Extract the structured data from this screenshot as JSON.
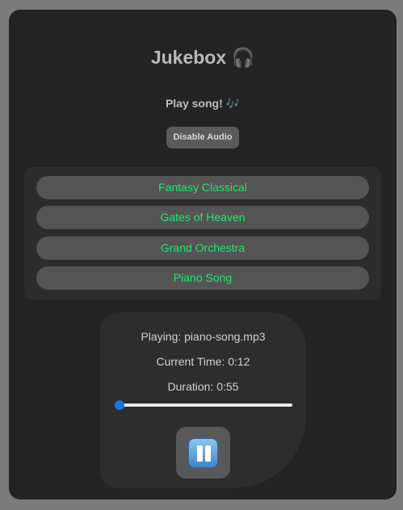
{
  "header": {
    "title": "Jukebox 🎧",
    "subtitle": "Play song! 🎶"
  },
  "controls": {
    "disable_audio_label": "Disable Audio"
  },
  "songs": [
    {
      "label": "Fantasy Classical"
    },
    {
      "label": "Gates of Heaven"
    },
    {
      "label": "Grand Orchestra"
    },
    {
      "label": "Piano Song"
    }
  ],
  "player": {
    "playing": "Playing: piano-song.mp3",
    "current_time": "Current Time: 0:12",
    "duration": "Duration: 0:55",
    "progress_fraction": 0,
    "pause_icon": "pause-icon"
  },
  "colors": {
    "song_text": "#1fe86b",
    "slider_accent": "#1a73e8"
  }
}
